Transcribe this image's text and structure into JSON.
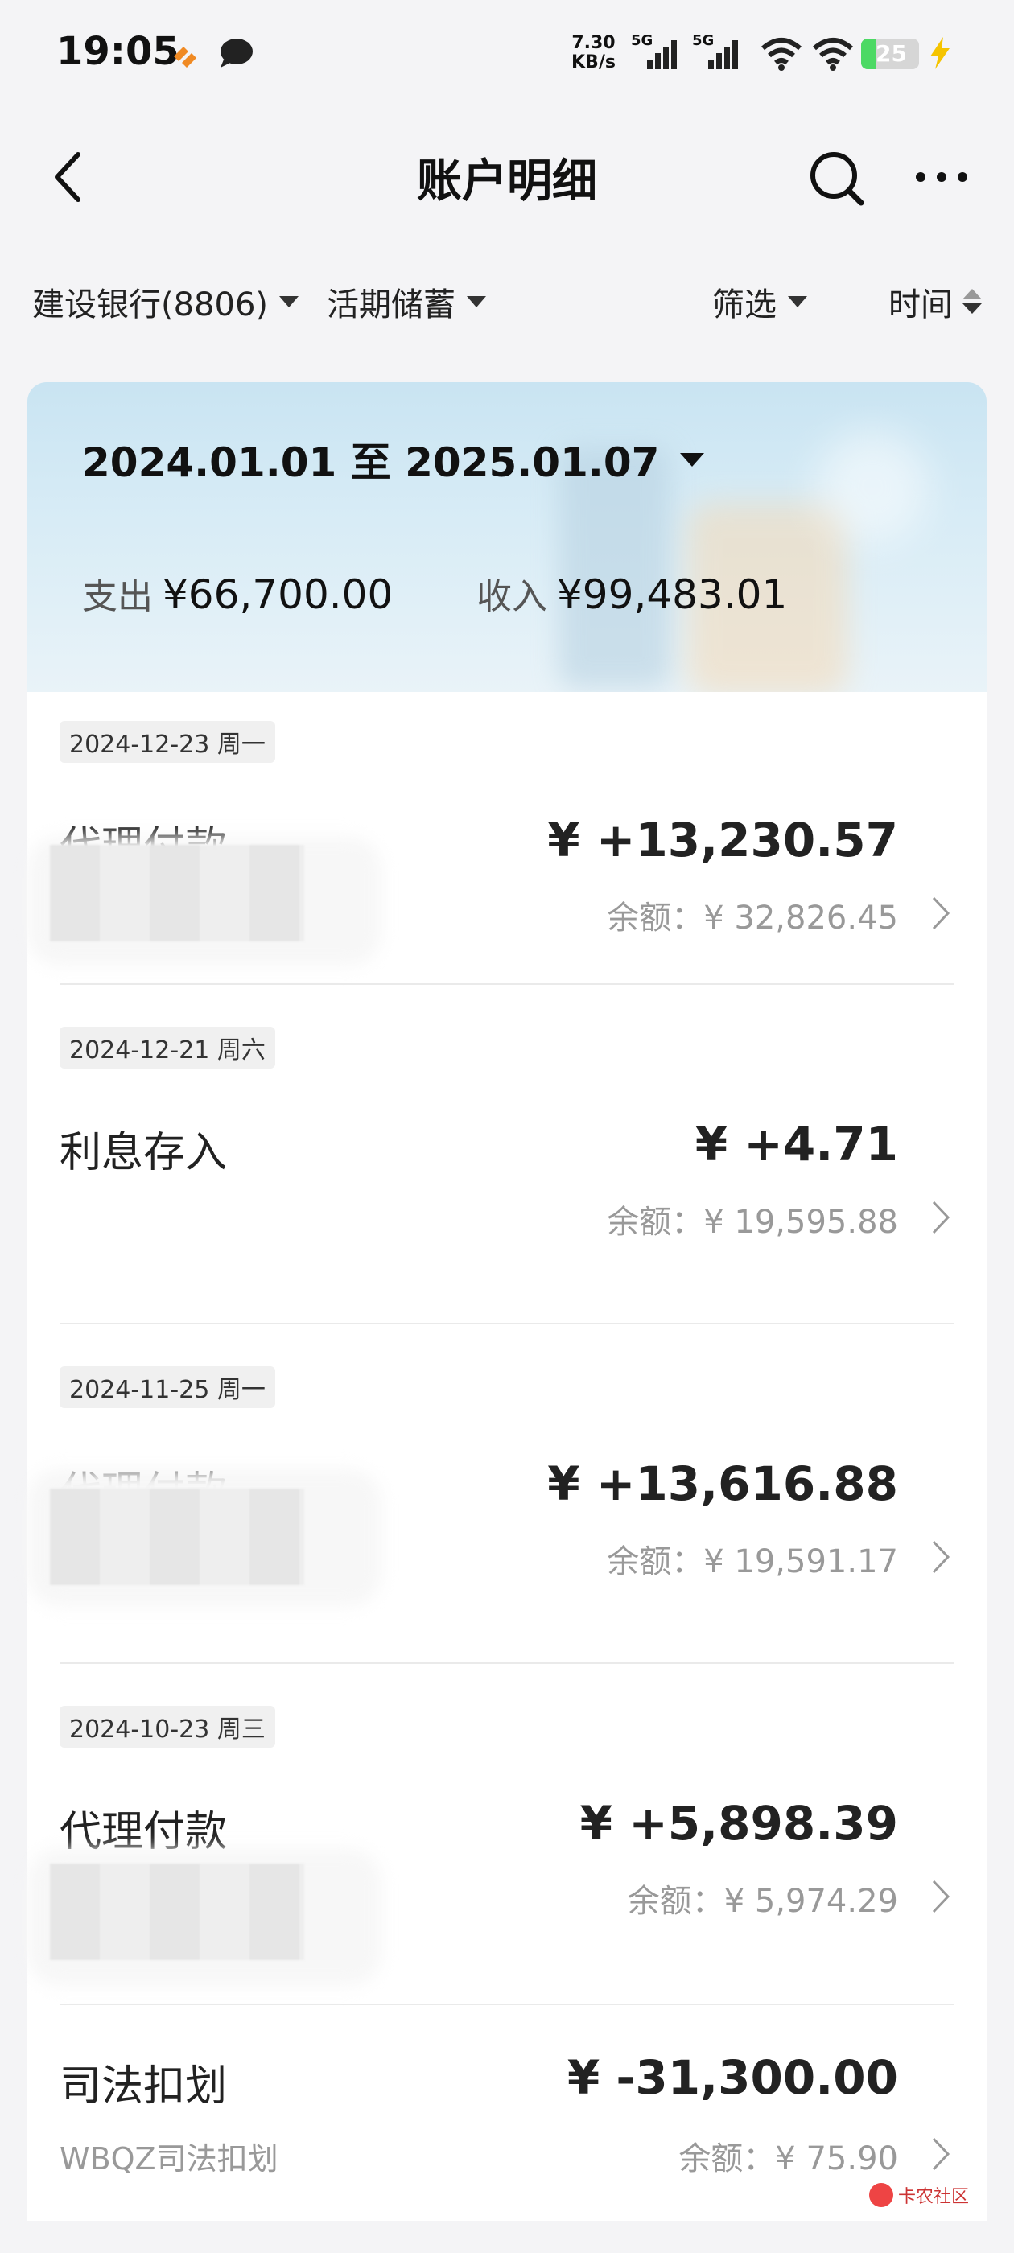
{
  "status": {
    "time": "19:05",
    "speed_value": "7.30",
    "speed_unit": "KB/s",
    "net1": "5G",
    "net2": "5G",
    "battery": "25",
    "battery_level": 0.25,
    "icons": [
      "app-notification-icon",
      "chat-icon",
      "signal-icon",
      "signal-icon",
      "wifi-icon",
      "wifi-icon",
      "battery-icon",
      "charging-icon"
    ]
  },
  "header": {
    "title": "账户明细",
    "icons": [
      "back-arrow-icon",
      "search-icon",
      "more-icon"
    ]
  },
  "filters": {
    "account": "建设银行(8806)",
    "type": "活期储蓄",
    "filter": "筛选",
    "sort": "时间"
  },
  "summary": {
    "date_range": "2024.01.01 至 2025.01.07",
    "expense_label": "支出",
    "expense_value": "¥66,700.00",
    "income_label": "收入",
    "income_value": "¥99,483.01"
  },
  "transactions": [
    {
      "date": "2024-12-23 周一",
      "title": "代理付款",
      "subtitle": "",
      "amount": "¥ +13,230.57",
      "balance": "余额：¥ 32,826.45"
    },
    {
      "date": "2024-12-21 周六",
      "title": "利息存入",
      "subtitle": "",
      "amount": "¥ +4.71",
      "balance": "余额：¥ 19,595.88"
    },
    {
      "date": "2024-11-25 周一",
      "title": "代理付款",
      "subtitle": "",
      "amount": "¥ +13,616.88",
      "balance": "余额：¥ 19,591.17"
    },
    {
      "date": "2024-10-23 周三",
      "title": "代理付款",
      "subtitle": "",
      "amount": "¥ +5,898.39",
      "balance": "余额：¥ 5,974.29"
    },
    {
      "date": "",
      "title": "司法扣划",
      "subtitle": "WBQZ司法扣划",
      "amount": "¥ -31,300.00",
      "balance": "余额：¥ 75.90"
    }
  ],
  "watermark": "卡农社区"
}
